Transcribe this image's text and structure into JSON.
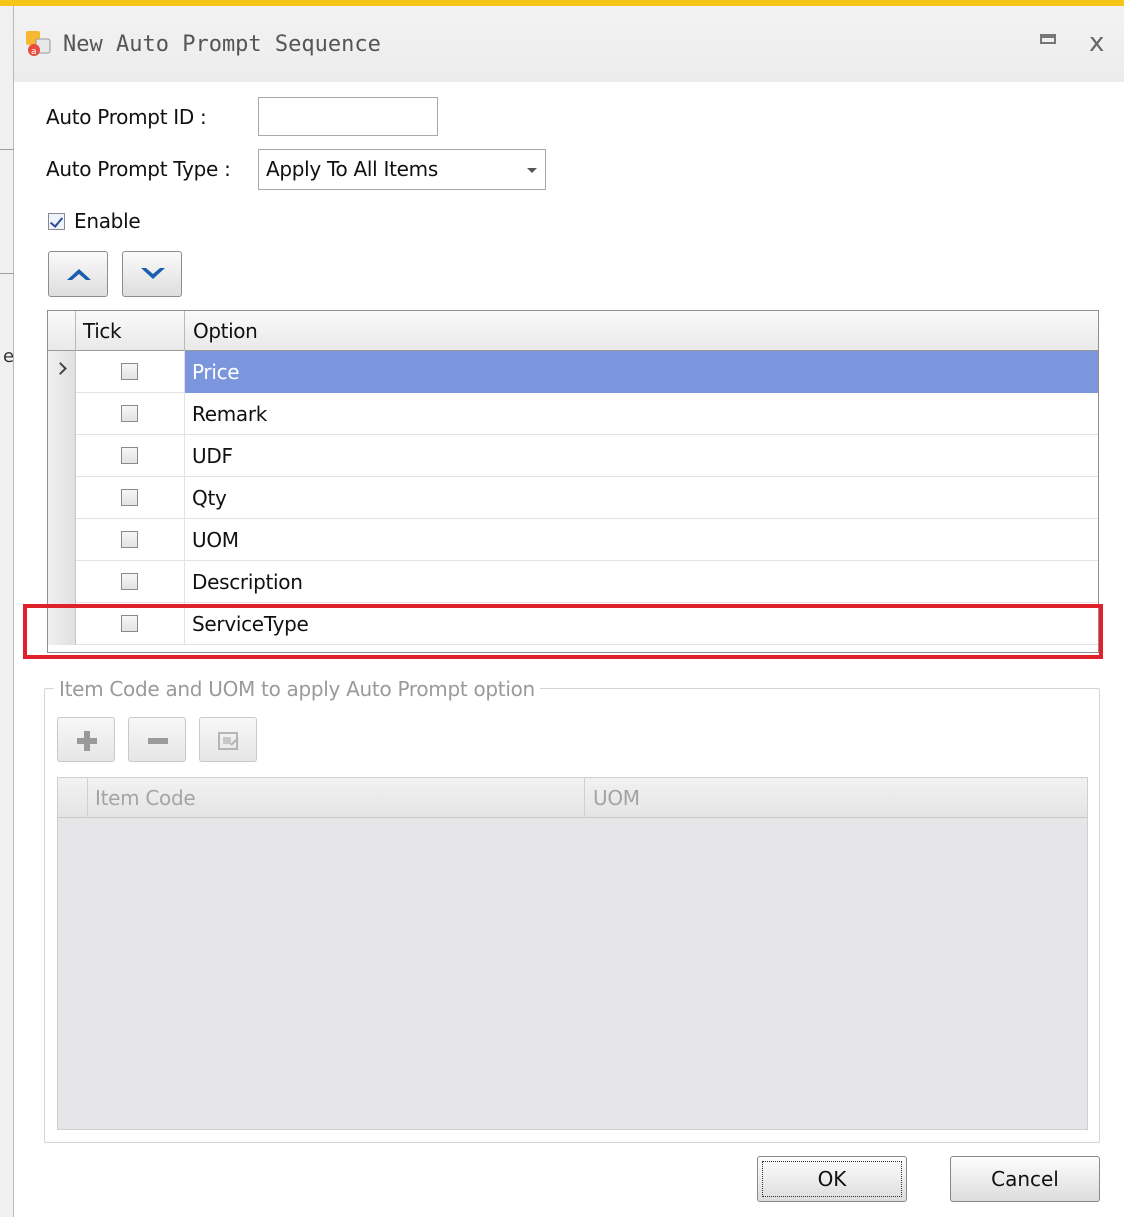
{
  "window": {
    "title": "New Auto Prompt Sequence",
    "app_icon": "app-logo-icon",
    "minimize_icon": "minimize-icon",
    "close_symbol": "x"
  },
  "form": {
    "auto_prompt_id_label": "Auto Prompt ID :",
    "auto_prompt_id_value": "",
    "auto_prompt_type_label": "Auto Prompt Type :",
    "auto_prompt_type_value": "Apply To All Items",
    "enable_label": "Enable",
    "enable_checked": true
  },
  "sequence_buttons": {
    "up_icon": "chevron-up-icon",
    "down_icon": "chevron-down-icon"
  },
  "options_grid": {
    "columns": [
      "Tick",
      "Option"
    ],
    "rows": [
      {
        "option": "Price",
        "ticked": false,
        "selected": true
      },
      {
        "option": "Remark",
        "ticked": false,
        "selected": false
      },
      {
        "option": "UDF",
        "ticked": false,
        "selected": false
      },
      {
        "option": "Qty",
        "ticked": false,
        "selected": false
      },
      {
        "option": "UOM",
        "ticked": false,
        "selected": false
      },
      {
        "option": "Description",
        "ticked": false,
        "selected": false
      },
      {
        "option": "ServiceType",
        "ticked": false,
        "selected": false
      }
    ],
    "highlight_color": "#e0202a",
    "selection_color": "#7b96dc"
  },
  "item_group": {
    "title": "Item Code and UOM to apply Auto Prompt option",
    "add_icon": "plus-icon",
    "remove_icon": "minus-icon",
    "edit_icon": "edit-icon",
    "columns": [
      "Item Code",
      "UOM"
    ]
  },
  "footer": {
    "ok_label": "OK",
    "cancel_label": "Cancel"
  },
  "colors": {
    "top_strip": "#f5c518"
  }
}
